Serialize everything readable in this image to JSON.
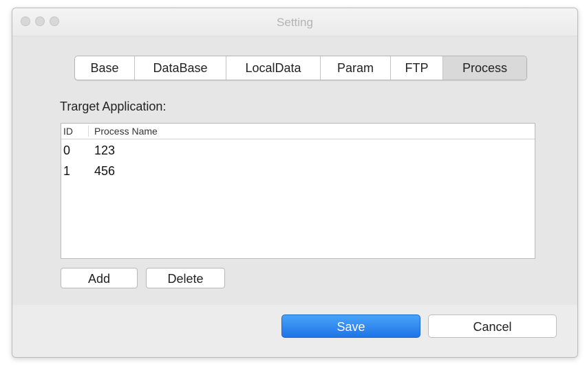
{
  "window": {
    "title": "Setting"
  },
  "tabs": [
    {
      "label": "Base"
    },
    {
      "label": "DataBase"
    },
    {
      "label": "LocalData"
    },
    {
      "label": "Param"
    },
    {
      "label": "FTP"
    },
    {
      "label": "Process",
      "selected": true
    }
  ],
  "process": {
    "section_label": "Trarget Application:",
    "columns": [
      "ID",
      "Process Name"
    ],
    "rows": [
      {
        "id": "0",
        "name": "123"
      },
      {
        "id": "1",
        "name": "456"
      }
    ],
    "add_label": "Add",
    "delete_label": "Delete"
  },
  "footer": {
    "save_label": "Save",
    "cancel_label": "Cancel"
  },
  "colors": {
    "accent": "#1d74e8",
    "window_bg": "#ececec"
  }
}
